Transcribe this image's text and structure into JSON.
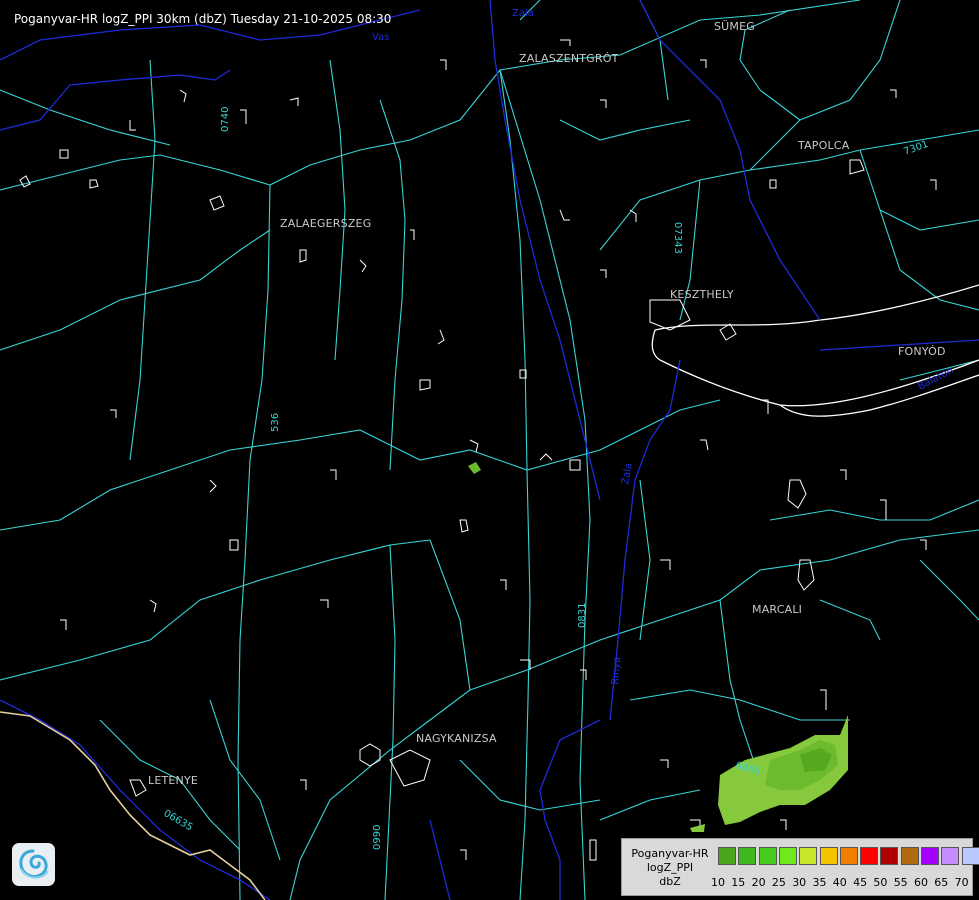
{
  "header": {
    "title": "Poganyvar-HR logZ_PPI 30km (dbZ) Tuesday 21-10-2025 08:30"
  },
  "cities": [
    {
      "key": "sumeg",
      "name": "SÜMEG"
    },
    {
      "key": "zalaszentgrot",
      "name": "ZALASZENTGRÓT"
    },
    {
      "key": "tapolca",
      "name": "TAPOLCA"
    },
    {
      "key": "zalaegerszeg",
      "name": "ZALAEGERSZEG"
    },
    {
      "key": "keszthely",
      "name": "KESZTHELY"
    },
    {
      "key": "fonyod",
      "name": "FONYÓD"
    },
    {
      "key": "marcali",
      "name": "MARCALI"
    },
    {
      "key": "nagykanizsa",
      "name": "NAGYKANIZSA"
    },
    {
      "key": "letenye",
      "name": "LETENYE"
    }
  ],
  "road_labels": [
    "0740",
    "07343",
    "7301",
    "536",
    "0831",
    "0990",
    "06635",
    "6865"
  ],
  "water_labels": [
    "Zala",
    "Vas",
    "Balaton",
    "Zala",
    "Rinya"
  ],
  "legend": {
    "line1": "Poganyvar-HR",
    "line2": "logZ_PPI",
    "line3": "dbZ",
    "ticks": [
      "10",
      "15",
      "20",
      "25",
      "30",
      "35",
      "40",
      "45",
      "50",
      "55",
      "60",
      "65",
      "70"
    ],
    "colors": [
      "#4ca31c",
      "#3db81f",
      "#47cc1e",
      "#6eea1b",
      "#c9e62a",
      "#f4c400",
      "#f07f00",
      "#ff0000",
      "#b00000",
      "#b06a10",
      "#a300ff",
      "#c58cff",
      "#b9c8ff"
    ]
  },
  "colors": {
    "background": "#000000",
    "roads": "#39d4d4",
    "settlements": "#ffffff",
    "rivers": "#1e2bd6",
    "border": "#e6cfa0",
    "echo_light": "#86c93c",
    "echo_mid": "#6cba2e",
    "echo_dark": "#56a81f"
  },
  "radar_echoes": [
    {
      "area": "south-east, east of Nagykanizsa",
      "dbz_range": "10-20"
    },
    {
      "area": "centre, east of Zalaegerszeg",
      "dbz_range": "10-15"
    }
  ]
}
